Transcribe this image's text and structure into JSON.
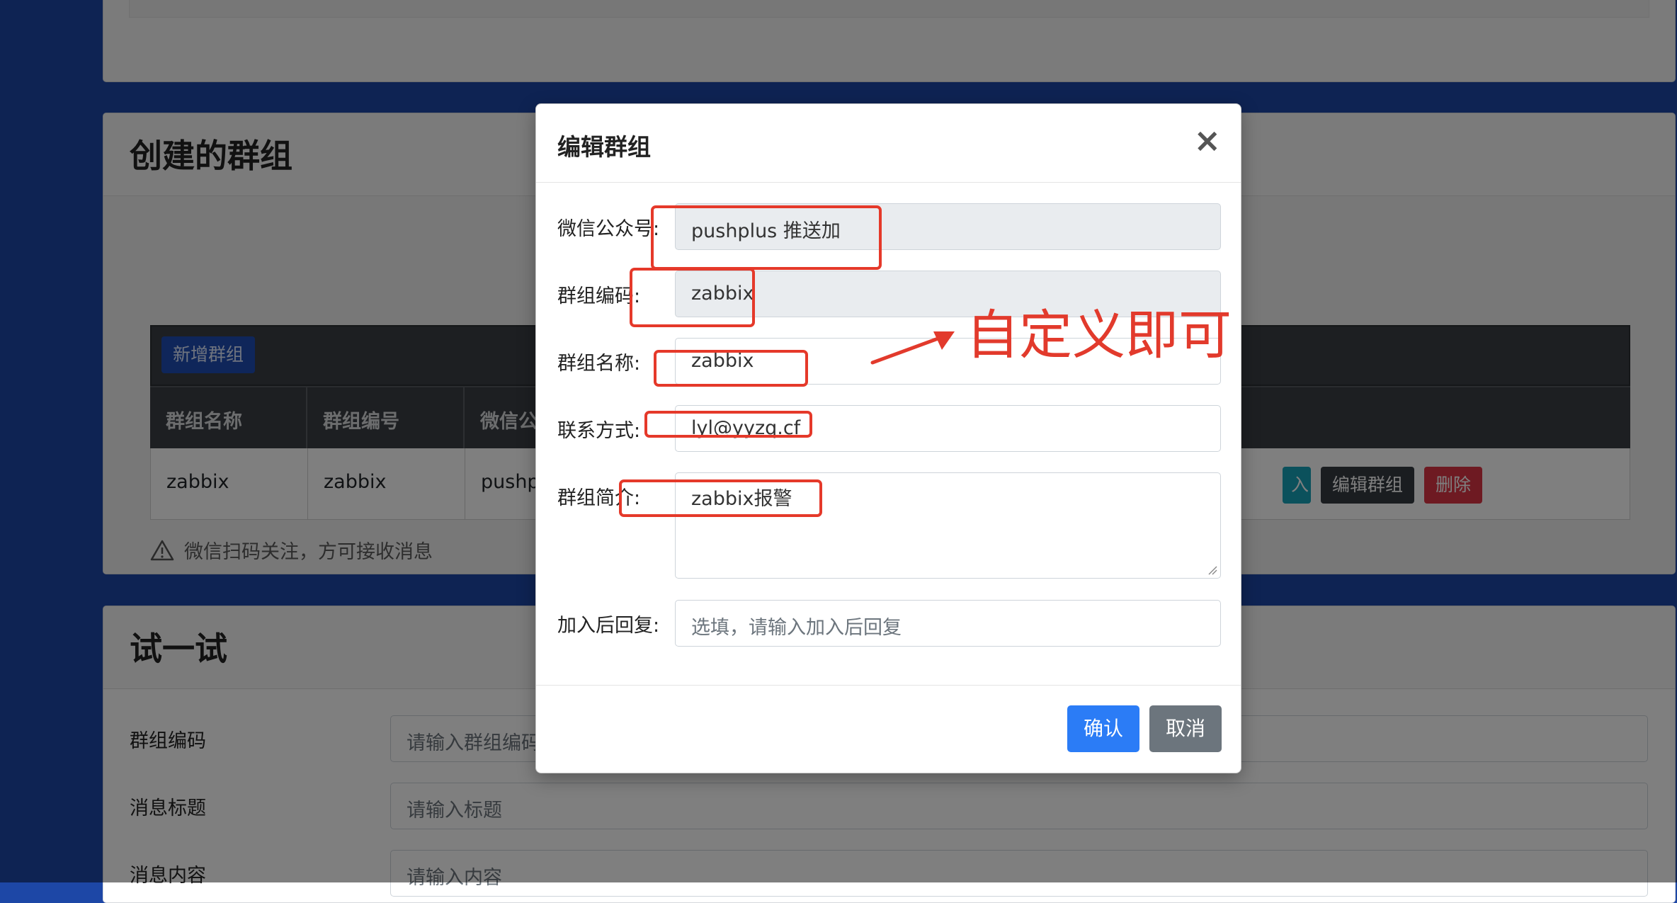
{
  "background_cards": {
    "created_groups": {
      "title": "创建的群组",
      "add_button": "新增群组",
      "columns": [
        "群组名称",
        "群组编号",
        "微信公"
      ],
      "row": [
        "zabbix",
        "zabbix",
        "pushp"
      ],
      "row_actions": {
        "join": "入",
        "edit": "编辑群组",
        "delete": "删除"
      },
      "notice": "微信扫码关注，方可接收消息"
    },
    "try_it": {
      "title": "试一试",
      "fields": [
        {
          "label": "群组编码",
          "placeholder": "请输入群组编码"
        },
        {
          "label": "消息标题",
          "placeholder": "请输入标题"
        },
        {
          "label": "消息内容",
          "placeholder": "请输入内容"
        }
      ]
    }
  },
  "modal": {
    "title": "编辑群组",
    "close_symbol": "×",
    "fields": [
      {
        "label": "微信公众号:",
        "value": "pushplus 推送加",
        "readonly": true
      },
      {
        "label": "群组编码:",
        "value": "zabbix",
        "readonly": true
      },
      {
        "label": "群组名称:",
        "value": "zabbix",
        "readonly": false
      },
      {
        "label": "联系方式:",
        "value": "lyl@yyzq.cf",
        "readonly": false
      },
      {
        "label": "群组简介:",
        "value": "zabbix报警",
        "readonly": false
      },
      {
        "label": "加入后回复:",
        "placeholder": "选填，请输入加入后回复",
        "readonly": false
      }
    ],
    "confirm_button": "确认",
    "cancel_button": "取消"
  },
  "annotation": {
    "text": "自定义即可",
    "color": "#e23a2c"
  },
  "colors": {
    "page_bg": "#1d47a6",
    "primary": "#2b7cf6",
    "secondary": "#6c757d",
    "danger": "#dc3545",
    "info": "#17a2b8"
  }
}
